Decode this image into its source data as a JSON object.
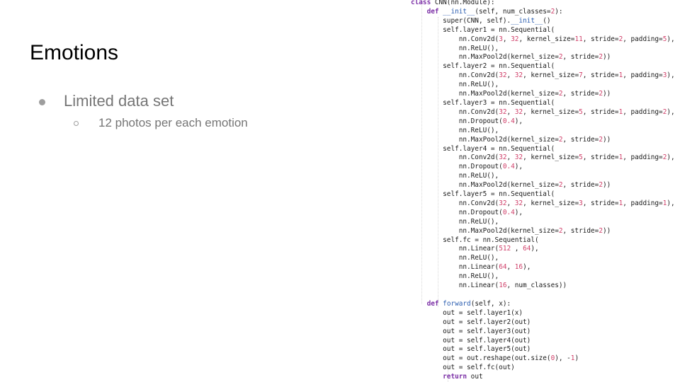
{
  "slide": {
    "title": "Emotions",
    "bullets": [
      {
        "text": "Limited data set",
        "sub": "12 photos per each emotion"
      }
    ]
  },
  "code": {
    "language": "python",
    "lines": [
      "class CNN(nn.Module):",
      "    def __init__(self, num_classes=2):",
      "        super(CNN, self).__init__()",
      "        self.layer1 = nn.Sequential(",
      "            nn.Conv2d(3, 32, kernel_size=11, stride=2, padding=5),",
      "            nn.ReLU(),",
      "            nn.MaxPool2d(kernel_size=2, stride=2))",
      "        self.layer2 = nn.Sequential(",
      "            nn.Conv2d(32, 32, kernel_size=7, stride=1, padding=3),",
      "            nn.ReLU(),",
      "            nn.MaxPool2d(kernel_size=2, stride=2))",
      "        self.layer3 = nn.Sequential(",
      "            nn.Conv2d(32, 32, kernel_size=5, stride=1, padding=2),",
      "            nn.Dropout(0.4),",
      "            nn.ReLU(),",
      "            nn.MaxPool2d(kernel_size=2, stride=2))",
      "        self.layer4 = nn.Sequential(",
      "            nn.Conv2d(32, 32, kernel_size=5, stride=1, padding=2),",
      "            nn.Dropout(0.4),",
      "            nn.ReLU(),",
      "            nn.MaxPool2d(kernel_size=2, stride=2))",
      "        self.layer5 = nn.Sequential(",
      "            nn.Conv2d(32, 32, kernel_size=3, stride=1, padding=1),",
      "            nn.Dropout(0.4),",
      "            nn.ReLU(),",
      "            nn.MaxPool2d(kernel_size=2, stride=2))",
      "        self.fc = nn.Sequential(",
      "            nn.Linear(512 , 64),",
      "            nn.ReLU(),",
      "            nn.Linear(64, 16),",
      "            nn.ReLU(),",
      "            nn.Linear(16, num_classes))",
      "",
      "    def forward(self, x):",
      "        out = self.layer1(x)",
      "        out = self.layer2(out)",
      "        out = self.layer3(out)",
      "        out = self.layer4(out)",
      "        out = self.layer5(out)",
      "        out = out.reshape(out.size(0), -1)",
      "        out = self.fc(out)",
      "        return out"
    ]
  }
}
